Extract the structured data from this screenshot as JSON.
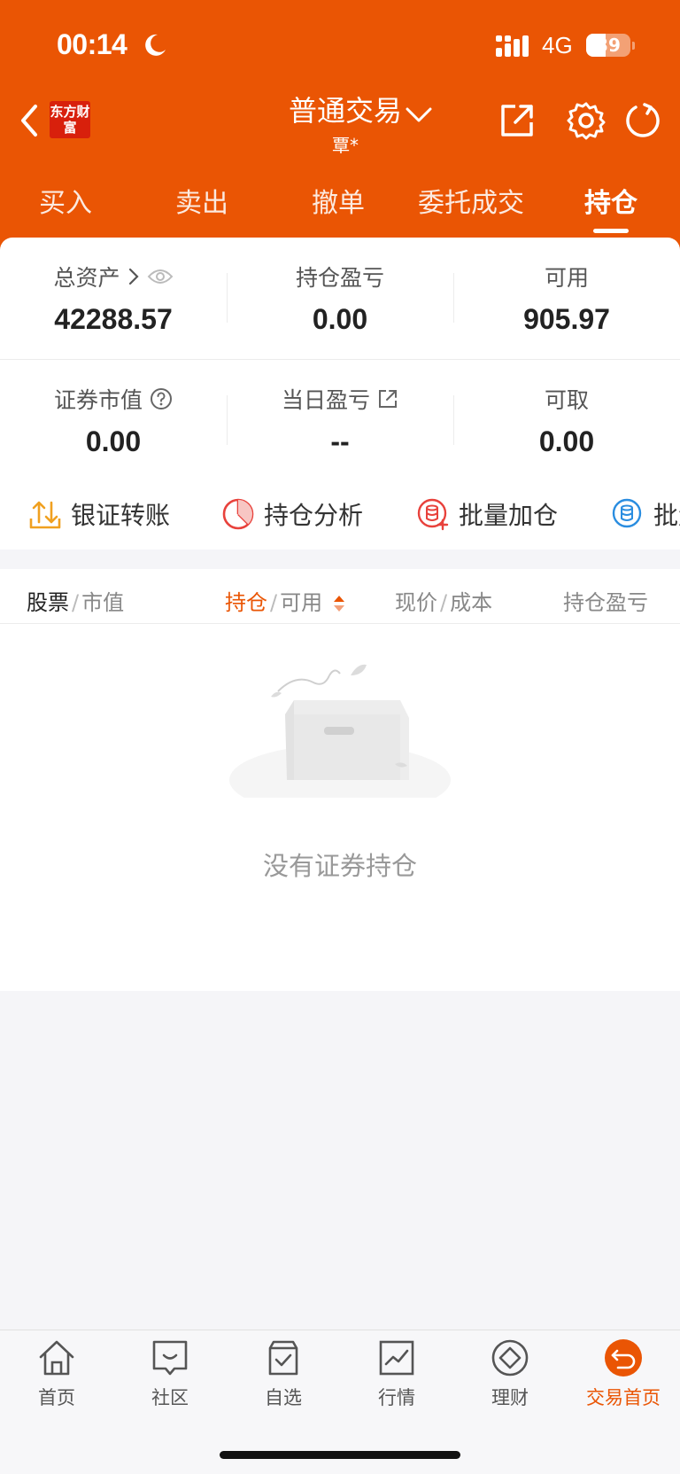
{
  "status_bar": {
    "time": "00:14",
    "network": "4G",
    "battery": "39"
  },
  "header": {
    "logo": "东方财富",
    "title": "普通交易",
    "account": "覃*"
  },
  "tabs": [
    "买入",
    "卖出",
    "撤单",
    "委托成交",
    "持仓"
  ],
  "active_tab": "持仓",
  "summary": {
    "total_assets_label": "总资产",
    "total_assets": "42288.57",
    "position_pl_label": "持仓盈亏",
    "position_pl": "0.00",
    "available_label": "可用",
    "available": "905.97",
    "market_value_label": "证券市值",
    "market_value": "0.00",
    "daily_pl_label": "当日盈亏",
    "daily_pl": "--",
    "withdrawable_label": "可取",
    "withdrawable": "0.00"
  },
  "quick_actions": [
    "银证转账",
    "持仓分析",
    "批量加仓",
    "批量"
  ],
  "list_header": {
    "stock": "股票",
    "market_value": "市值",
    "holding": "持仓",
    "available": "可用",
    "price": "现价",
    "cost": "成本",
    "pl": "持仓盈亏"
  },
  "empty_message": "没有证券持仓",
  "bottom_nav": [
    "首页",
    "社区",
    "自选",
    "行情",
    "理财",
    "交易首页"
  ],
  "colors": {
    "brand": "#ea5504",
    "logo_red": "#d8200c",
    "background": "#f5f5f8"
  }
}
